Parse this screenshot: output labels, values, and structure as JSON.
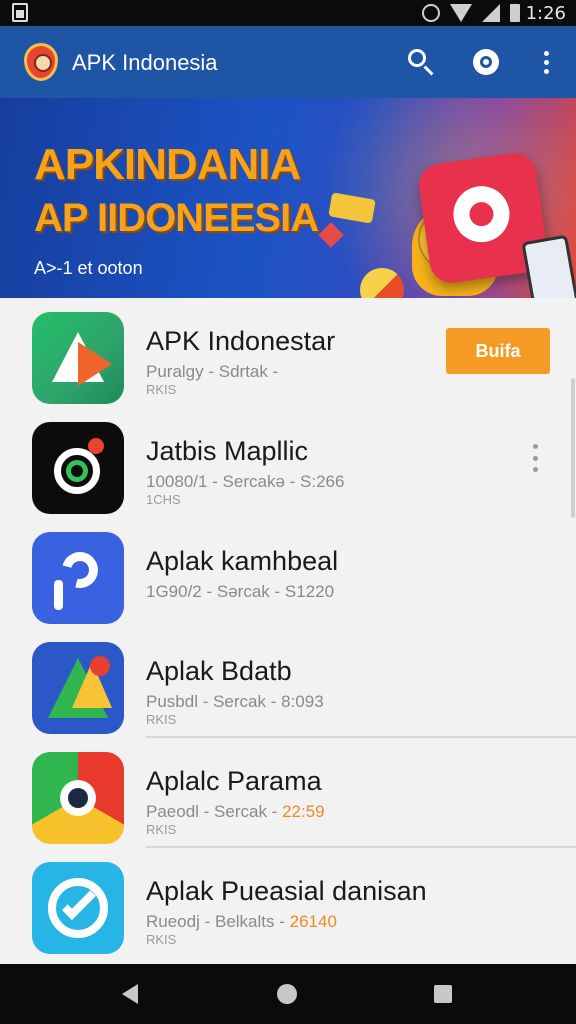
{
  "status_bar": {
    "time": "1:26",
    "icons": [
      "screenshot-icon",
      "alarm-icon",
      "wifi-icon",
      "signal-icon",
      "battery-icon"
    ]
  },
  "app_bar": {
    "title": "APK Indonesia",
    "icons": [
      "app-logo-icon",
      "search-icon",
      "account-icon",
      "more-vert-icon"
    ],
    "color": "#1f55a5"
  },
  "banner": {
    "title_line1": "APKINDANIA",
    "title_line2": "AP IIDONEESIA",
    "subtitle": "A>-1 et ooton"
  },
  "apps": [
    {
      "name": "APK Indonestar",
      "meta": "Puralgy - Sdrtak -",
      "meta2": "RKIS",
      "action": "Buifa"
    },
    {
      "name": "Jatbis Mapllic",
      "meta": "10080/1 - Sercakə - S:266",
      "meta2": "1CHS",
      "action": ""
    },
    {
      "name": "Aplak kamhbeal",
      "meta": "1G90/2 - Sərcak - S1220",
      "meta2": "",
      "action": ""
    },
    {
      "name": "Aplak Bdatb",
      "meta": "Pusbdl - Sercak - 8:093",
      "meta2": "RKIS",
      "action": ""
    },
    {
      "name": "Aplalc Parama",
      "meta": "Paeodl - Sercak - ",
      "meta_accent": "22:59",
      "meta2": "RKIS",
      "action": ""
    },
    {
      "name": "Aplak Pueasial danisan",
      "meta": "Rueodj - Belkalts - ",
      "meta_accent": "26140",
      "meta2": "RKIS",
      "action": ""
    }
  ],
  "accent_color": "#f59a24",
  "nav_bar": {
    "icons": [
      "back-icon",
      "home-icon",
      "recents-icon"
    ]
  }
}
